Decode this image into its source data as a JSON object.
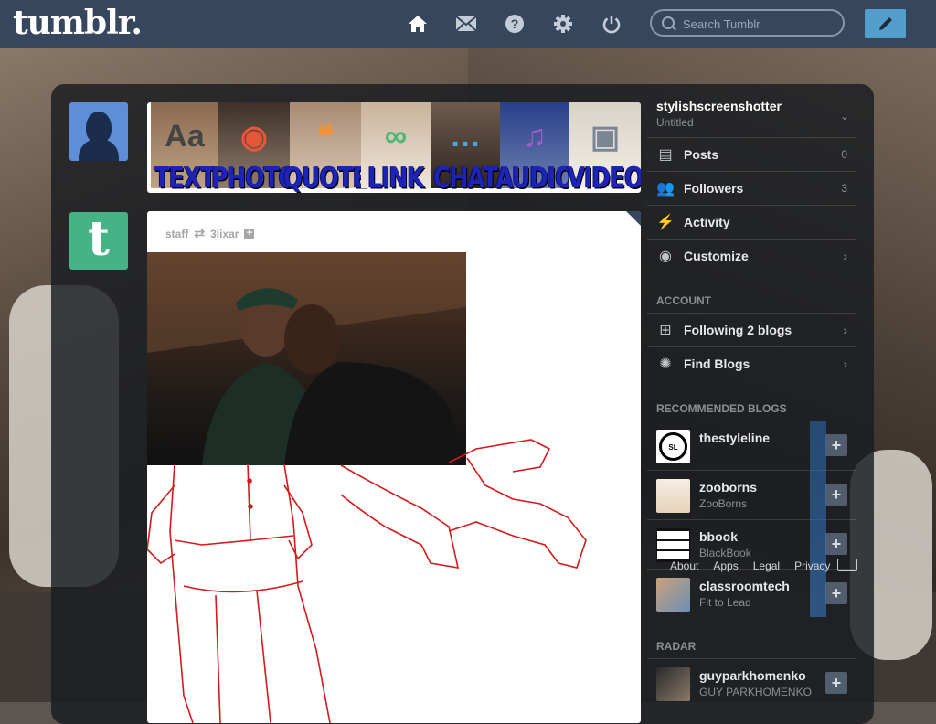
{
  "header": {
    "logo": "tumblr.",
    "search_placeholder": "Search Tumblr",
    "nav": [
      "home-icon",
      "mail-icon",
      "help-icon",
      "gear-icon",
      "power-icon"
    ],
    "compose_icon": "pencil-icon"
  },
  "post_types": [
    {
      "label": "TEXT",
      "glyph": "Aa",
      "color": "#444444"
    },
    {
      "label": "PHOTO",
      "glyph": "◉",
      "color": "#e8563a"
    },
    {
      "label": "QUOTE",
      "glyph": "❝",
      "color": "#f29236"
    },
    {
      "label": "LINK",
      "glyph": "∞",
      "color": "#49b97a"
    },
    {
      "label": "CHAT",
      "glyph": "…",
      "color": "#4aa6d8"
    },
    {
      "label": "AUDIO",
      "glyph": "♫",
      "color": "#9d5fc6"
    },
    {
      "label": "VIDEO",
      "glyph": "▣",
      "color": "#7b8694"
    }
  ],
  "post": {
    "author": "staff",
    "reblogged_from": "3lixar"
  },
  "sidebar": {
    "blog_name": "stylishscreenshotter",
    "blog_subtitle": "Untitled",
    "menu": [
      {
        "label": "Posts",
        "count": "0",
        "icon": "posts-icon"
      },
      {
        "label": "Followers",
        "count": "3",
        "icon": "followers-icon"
      },
      {
        "label": "Activity",
        "count": "",
        "icon": "activity-icon"
      },
      {
        "label": "Customize",
        "count": "",
        "icon": "eye-icon"
      }
    ],
    "account_heading": "ACCOUNT",
    "account_items": [
      {
        "label": "Following 2 blogs",
        "icon": "following-icon"
      },
      {
        "label": "Find Blogs",
        "icon": "find-blogs-icon"
      }
    ],
    "recommended_heading": "RECOMMENDED BLOGS",
    "recommended": [
      {
        "name": "thestyleline",
        "subtitle": ""
      },
      {
        "name": "zooborns",
        "subtitle": "ZooBorns"
      },
      {
        "name": "bbook",
        "subtitle": "BlackBook"
      },
      {
        "name": "classroomtech",
        "subtitle": "Fit to Lead"
      }
    ],
    "radar_heading": "RADAR",
    "radar": {
      "name": "guyparkhomenko",
      "subtitle": "GUY PARKHOMENKO"
    },
    "footer_links": [
      "About",
      "Apps",
      "Legal",
      "Privacy"
    ]
  }
}
